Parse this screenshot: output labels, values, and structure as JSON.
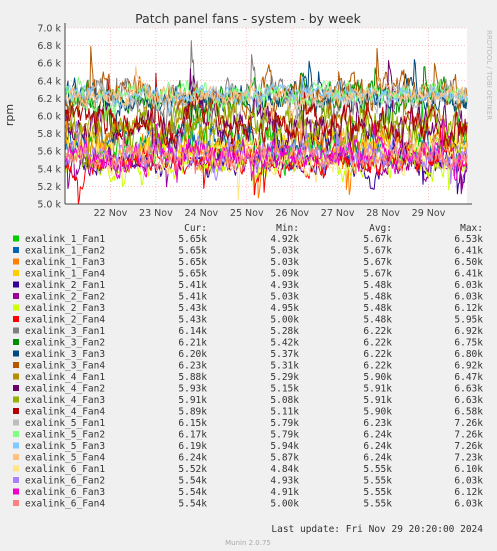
{
  "chart_data": {
    "type": "line",
    "title": "Patch panel fans - system - by week",
    "ylabel": "rpm",
    "ylim": [
      5000,
      7000
    ],
    "y_ticks": [
      5000,
      5200,
      5400,
      5600,
      5800,
      6000,
      6200,
      6400,
      6600,
      6800,
      7000
    ],
    "y_tick_labels": [
      "5.0 k",
      "5.2 k",
      "5.4 k",
      "5.6 k",
      "5.8 k",
      "6.0 k",
      "6.2 k",
      "6.4 k",
      "6.6 k",
      "6.8 k",
      "7.0 k"
    ],
    "x_range": [
      "2024-11-21",
      "2024-11-29 20:20"
    ],
    "x_ticks": [
      "2024-11-22",
      "2024-11-23",
      "2024-11-24",
      "2024-11-25",
      "2024-11-26",
      "2024-11-27",
      "2024-11-28",
      "2024-11-29"
    ],
    "x_tick_labels": [
      "22 Nov",
      "23 Nov",
      "24 Nov",
      "25 Nov",
      "26 Nov",
      "27 Nov",
      "28 Nov",
      "29 Nov"
    ],
    "grid": true,
    "legend_position": "bottom",
    "columns": [
      "Cur:",
      "Min:",
      "Avg:",
      "Max:"
    ],
    "series": [
      {
        "name": "exalink_1_Fan1",
        "color": "#00CC00",
        "cur": "5.65k",
        "min": "4.92k",
        "avg": "5.67k",
        "max": "6.53k",
        "curv": 5650,
        "minv": 4920,
        "avgv": 5670,
        "maxv": 6530
      },
      {
        "name": "exalink_1_Fan2",
        "color": "#0066B3",
        "cur": "5.65k",
        "min": "5.03k",
        "avg": "5.67k",
        "max": "6.41k",
        "curv": 5650,
        "minv": 5030,
        "avgv": 5670,
        "maxv": 6410
      },
      {
        "name": "exalink_1_Fan3",
        "color": "#FF8000",
        "cur": "5.65k",
        "min": "5.03k",
        "avg": "5.67k",
        "max": "6.50k",
        "curv": 5650,
        "minv": 5030,
        "avgv": 5670,
        "maxv": 6500
      },
      {
        "name": "exalink_1_Fan4",
        "color": "#FFCC00",
        "cur": "5.65k",
        "min": "5.09k",
        "avg": "5.67k",
        "max": "6.41k",
        "curv": 5650,
        "minv": 5090,
        "avgv": 5670,
        "maxv": 6410
      },
      {
        "name": "exalink_2_Fan1",
        "color": "#330099",
        "cur": "5.41k",
        "min": "4.93k",
        "avg": "5.48k",
        "max": "6.03k",
        "curv": 5410,
        "minv": 4930,
        "avgv": 5480,
        "maxv": 6030
      },
      {
        "name": "exalink_2_Fan2",
        "color": "#990099",
        "cur": "5.41k",
        "min": "5.03k",
        "avg": "5.48k",
        "max": "6.03k",
        "curv": 5410,
        "minv": 5030,
        "avgv": 5480,
        "maxv": 6030
      },
      {
        "name": "exalink_2_Fan3",
        "color": "#CCFF00",
        "cur": "5.43k",
        "min": "4.95k",
        "avg": "5.48k",
        "max": "6.12k",
        "curv": 5430,
        "minv": 4950,
        "avgv": 5480,
        "maxv": 6120
      },
      {
        "name": "exalink_2_Fan4",
        "color": "#FF0000",
        "cur": "5.43k",
        "min": "5.00k",
        "avg": "5.48k",
        "max": "5.95k",
        "curv": 5430,
        "minv": 5000,
        "avgv": 5480,
        "maxv": 5950
      },
      {
        "name": "exalink_3_Fan1",
        "color": "#808080",
        "cur": "6.14k",
        "min": "5.28k",
        "avg": "6.22k",
        "max": "6.92k",
        "curv": 6140,
        "minv": 5280,
        "avgv": 6220,
        "maxv": 6920
      },
      {
        "name": "exalink_3_Fan2",
        "color": "#008F00",
        "cur": "6.21k",
        "min": "5.42k",
        "avg": "6.22k",
        "max": "6.75k",
        "curv": 6210,
        "minv": 5420,
        "avgv": 6220,
        "maxv": 6750
      },
      {
        "name": "exalink_3_Fan3",
        "color": "#00487D",
        "cur": "6.20k",
        "min": "5.37k",
        "avg": "6.22k",
        "max": "6.80k",
        "curv": 6200,
        "minv": 5370,
        "avgv": 6220,
        "maxv": 6800
      },
      {
        "name": "exalink_3_Fan4",
        "color": "#B35A00",
        "cur": "6.23k",
        "min": "5.31k",
        "avg": "6.22k",
        "max": "6.92k",
        "curv": 6230,
        "minv": 5310,
        "avgv": 6220,
        "maxv": 6920
      },
      {
        "name": "exalink_4_Fan1",
        "color": "#B38F00",
        "cur": "5.88k",
        "min": "5.29k",
        "avg": "5.90k",
        "max": "6.47k",
        "curv": 5880,
        "minv": 5290,
        "avgv": 5900,
        "maxv": 6470
      },
      {
        "name": "exalink_4_Fan2",
        "color": "#6B006B",
        "cur": "5.93k",
        "min": "5.15k",
        "avg": "5.91k",
        "max": "6.63k",
        "curv": 5930,
        "minv": 5150,
        "avgv": 5910,
        "maxv": 6630
      },
      {
        "name": "exalink_4_Fan3",
        "color": "#8FB300",
        "cur": "5.91k",
        "min": "5.08k",
        "avg": "5.91k",
        "max": "6.63k",
        "curv": 5910,
        "minv": 5080,
        "avgv": 5910,
        "maxv": 6630
      },
      {
        "name": "exalink_4_Fan4",
        "color": "#B30000",
        "cur": "5.89k",
        "min": "5.11k",
        "avg": "5.90k",
        "max": "6.58k",
        "curv": 5890,
        "minv": 5110,
        "avgv": 5900,
        "maxv": 6580
      },
      {
        "name": "exalink_5_Fan1",
        "color": "#BEBEBE",
        "cur": "6.15k",
        "min": "5.79k",
        "avg": "6.23k",
        "max": "7.26k",
        "curv": 6150,
        "minv": 5790,
        "avgv": 6230,
        "maxv": 7260
      },
      {
        "name": "exalink_5_Fan2",
        "color": "#80FF80",
        "cur": "6.17k",
        "min": "5.79k",
        "avg": "6.24k",
        "max": "7.26k",
        "curv": 6170,
        "minv": 5790,
        "avgv": 6240,
        "maxv": 7260
      },
      {
        "name": "exalink_5_Fan3",
        "color": "#80C9FF",
        "cur": "6.19k",
        "min": "5.94k",
        "avg": "6.24k",
        "max": "7.26k",
        "curv": 6190,
        "minv": 5940,
        "avgv": 6240,
        "maxv": 7260
      },
      {
        "name": "exalink_5_Fan4",
        "color": "#FFC080",
        "cur": "6.24k",
        "min": "5.87k",
        "avg": "6.24k",
        "max": "7.23k",
        "curv": 6240,
        "minv": 5870,
        "avgv": 6240,
        "maxv": 7230
      },
      {
        "name": "exalink_6_Fan1",
        "color": "#FFE680",
        "cur": "5.52k",
        "min": "4.84k",
        "avg": "5.55k",
        "max": "6.10k",
        "curv": 5520,
        "minv": 4840,
        "avgv": 5550,
        "maxv": 6100
      },
      {
        "name": "exalink_6_Fan2",
        "color": "#AA80FF",
        "cur": "5.54k",
        "min": "4.93k",
        "avg": "5.55k",
        "max": "6.03k",
        "curv": 5540,
        "minv": 4930,
        "avgv": 5550,
        "maxv": 6030
      },
      {
        "name": "exalink_6_Fan3",
        "color": "#EE00CC",
        "cur": "5.54k",
        "min": "4.91k",
        "avg": "5.55k",
        "max": "6.12k",
        "curv": 5540,
        "minv": 4910,
        "avgv": 5550,
        "maxv": 6120
      },
      {
        "name": "exalink_6_Fan4",
        "color": "#FF8080",
        "cur": "5.54k",
        "min": "5.00k",
        "avg": "5.55k",
        "max": "6.03k",
        "curv": 5540,
        "minv": 5000,
        "avgv": 5550,
        "maxv": 6030
      }
    ]
  },
  "side_label": "RRDTOOL / TOBI OETIKER",
  "last_update": "Last update: Fri Nov 29 20:20:00 2024",
  "footer": "Munin 2.0.75"
}
